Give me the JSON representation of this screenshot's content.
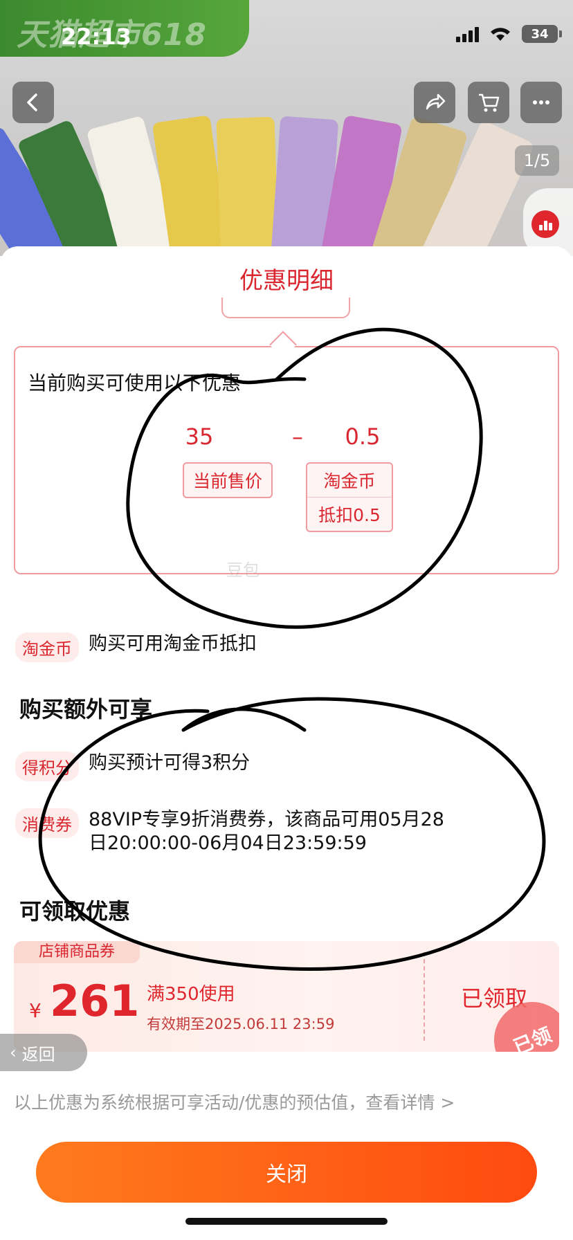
{
  "status_bar": {
    "time": "22:13",
    "battery": "34"
  },
  "hero": {
    "brand_text": "天猫超市618",
    "image_counter": "1/5"
  },
  "sheet": {
    "title": "优惠明细",
    "promo": {
      "heading": "当前购买可使用以下优惠",
      "price_value": "35",
      "minus": "–",
      "discount_value": "0.5",
      "price_label": "当前售价",
      "discount_label": "淘金币",
      "discount_sub": "抵扣0.5",
      "watermark": "豆包"
    },
    "coin_row": {
      "tag": "淘金币",
      "text": "购买可用淘金币抵扣"
    },
    "extra_title": "购买额外可享",
    "points_row": {
      "tag": "得积分",
      "text": "购买预计可得3积分"
    },
    "voucher_row": {
      "tag": "消费券",
      "text": "88VIP专享9折消费券，该商品可用05月28日20:00:00-06月04日23:59:59"
    },
    "claim_title": "可领取优惠",
    "coupon": {
      "label": "店铺商品券",
      "currency": "¥",
      "amount": "261",
      "condition": "满350使用",
      "validity": "有效期至2025.06.11 23:59",
      "status": "已领取",
      "stamp": "已领"
    },
    "back_label": "返回",
    "footnote": "以上优惠为系统根据可享活动/优惠的预估值，查看详情 >",
    "close_label": "关闭"
  },
  "colors": {
    "accent": "#d9262f",
    "button_start": "#ff7b1d",
    "button_end": "#ff4a10"
  }
}
